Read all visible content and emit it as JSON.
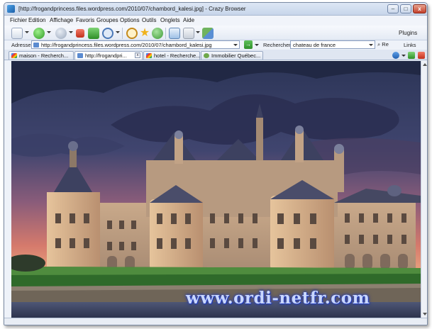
{
  "window": {
    "title": "[http://frogandprincess.files.wordpress.com/2010/07/chambord_kalesi.jpg] - Crazy Browser",
    "minimize_label": "–",
    "maximize_label": "□",
    "close_label": "x"
  },
  "menu": {
    "items": [
      {
        "label": "Fichier"
      },
      {
        "label": "Edition"
      },
      {
        "label": "Affichage"
      },
      {
        "label": "Favoris"
      },
      {
        "label": "Groupes"
      },
      {
        "label": "Options"
      },
      {
        "label": "Outils"
      },
      {
        "label": "Onglets"
      },
      {
        "label": "Aide"
      }
    ]
  },
  "toolbar": {
    "plugins_label": "Plugins",
    "icons": [
      "new-page-icon",
      "back-icon",
      "forward-icon",
      "stop-icon",
      "refresh-icon",
      "zoom-icon",
      "search-icon",
      "favorites-star-icon",
      "history-icon",
      "screen-icon",
      "rss-icon",
      "group-icon"
    ]
  },
  "address": {
    "label": "Adresse",
    "value": "http://frogandprincess.files.wordpress.com/2010/07/chambord_kalesi.jpg",
    "go_label": "→"
  },
  "search": {
    "label": "Rechercher",
    "value": "chateau de france",
    "go_label": "Re",
    "links_label": "Links"
  },
  "tabs": [
    {
      "label": "maison - Recherch...",
      "active": false,
      "favicon_color": "#e24a3b"
    },
    {
      "label": "http://frogandpri...",
      "active": true,
      "favicon_color": "#5b8bd0"
    },
    {
      "label": "hotel - Recherche...",
      "active": false,
      "favicon_color": "#e24a3b"
    },
    {
      "label": "Immobilier Québec...",
      "active": false,
      "favicon_color": "#6fa84a"
    }
  ],
  "tab_close_label": "x",
  "page": {
    "image_subject": "chateau-de-chambord-photo",
    "watermark": "www.ordi-netfr.com"
  },
  "colors": {
    "title_bar": "#c7d5ea",
    "go_button": "#2f8f2b",
    "watermark_glow": "#2b47c9"
  }
}
